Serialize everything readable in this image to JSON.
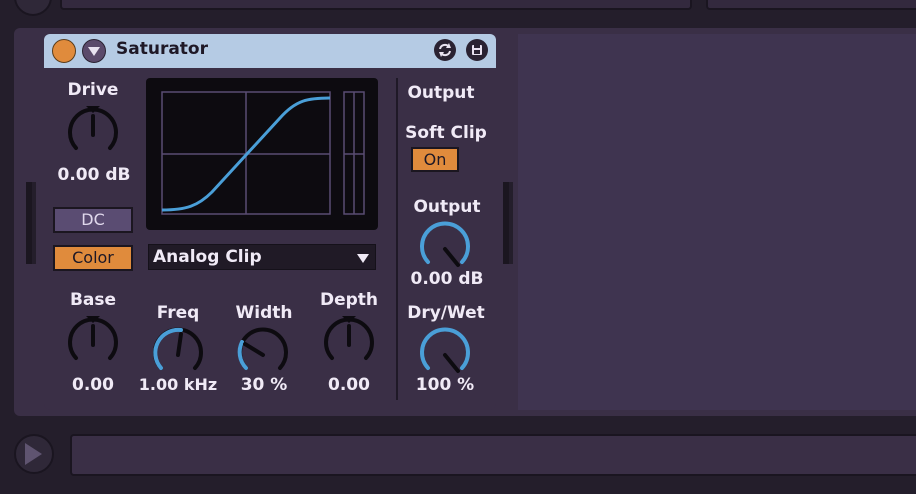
{
  "device": {
    "title": "Saturator",
    "drive": {
      "label": "Drive",
      "value": "0.00 dB"
    },
    "dc_label": "DC",
    "color_label": "Color",
    "curve_type": "Analog Clip",
    "base": {
      "label": "Base",
      "value": "0.00"
    },
    "freq": {
      "label": "Freq",
      "value": "1.00 kHz"
    },
    "width": {
      "label": "Width",
      "value": "30 %"
    },
    "depth": {
      "label": "Depth",
      "value": "0.00"
    },
    "output_section": {
      "heading": "Output",
      "soft_clip_label": "Soft Clip",
      "soft_clip_state": "On",
      "output": {
        "label": "Output",
        "value": "0.00 dB"
      },
      "dry_wet": {
        "label": "Dry/Wet",
        "value": "100 %"
      }
    }
  },
  "colors": {
    "titlebar": "#b5cbe4",
    "accent_orange": "#e08b3c",
    "knob_blue": "#4a9fd8",
    "panel": "#3a2f46"
  },
  "icons": {
    "device_on": "power-toggle-icon",
    "fold": "chevron-down-icon",
    "hot_swap": "hot-swap-icon",
    "save_preset": "save-icon",
    "play": "play-icon"
  }
}
